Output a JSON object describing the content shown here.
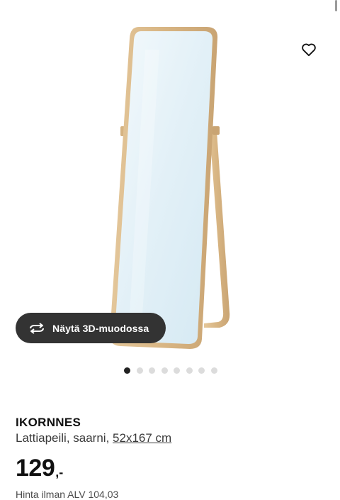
{
  "product": {
    "name": "IKORNNES",
    "description": "Lattiapeili, saarni,",
    "size": "52x167 cm",
    "price_integer": "129",
    "price_suffix": ",-",
    "vat_text": "Hinta ilman ALV 104,03"
  },
  "gallery": {
    "view_3d_label": "Näytä 3D-muodossa",
    "image_count": 8,
    "active_index": 0,
    "favourite_icon": "heart-outline-icon",
    "view_3d_icon": "rotate-arrows-icon"
  },
  "colors": {
    "frame": "#d9b98a",
    "glass": "#e3f1f8",
    "button_bg": "#333333"
  }
}
